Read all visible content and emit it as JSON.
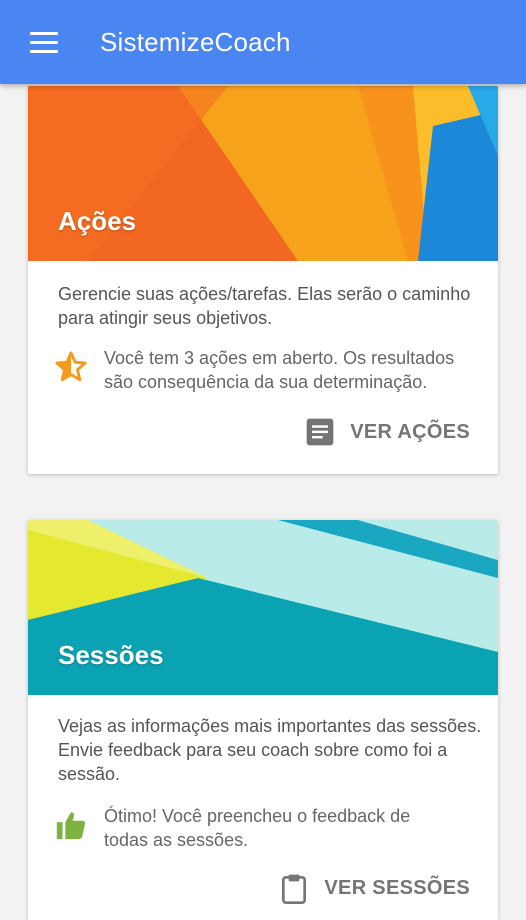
{
  "appbar": {
    "title": "SistemizeCoach",
    "menu_icon": "hamburger-menu-icon",
    "color": "#4a86f2"
  },
  "cards": {
    "acoes": {
      "title": "Ações",
      "description": "Gerencie suas ações/tarefas. Elas serão o caminho para atingir seus objetivos.",
      "status_line1": "Você tem 3 ações em aberto. Os resultados",
      "status_line2": "são consequência da sua determinação.",
      "status_icon": "star-half-icon",
      "action_label": "VER AÇÕES",
      "action_icon": "list-document-icon"
    },
    "sessoes": {
      "title": "Sessões",
      "description": "Vejas as informações mais importantes das sessões. Envie feedback para seu coach sobre como foi a sessão.",
      "status_line1": "Ótimo! Você preencheu o feedback de",
      "status_line2": "todas as sessões.",
      "status_icon": "thumbs-up-icon",
      "action_label": "VER SESSÕES",
      "action_icon": "clipboard-icon"
    }
  },
  "colors": {
    "star": "#f39a1e",
    "thumb": "#7cb342",
    "action_icon": "#757575"
  }
}
